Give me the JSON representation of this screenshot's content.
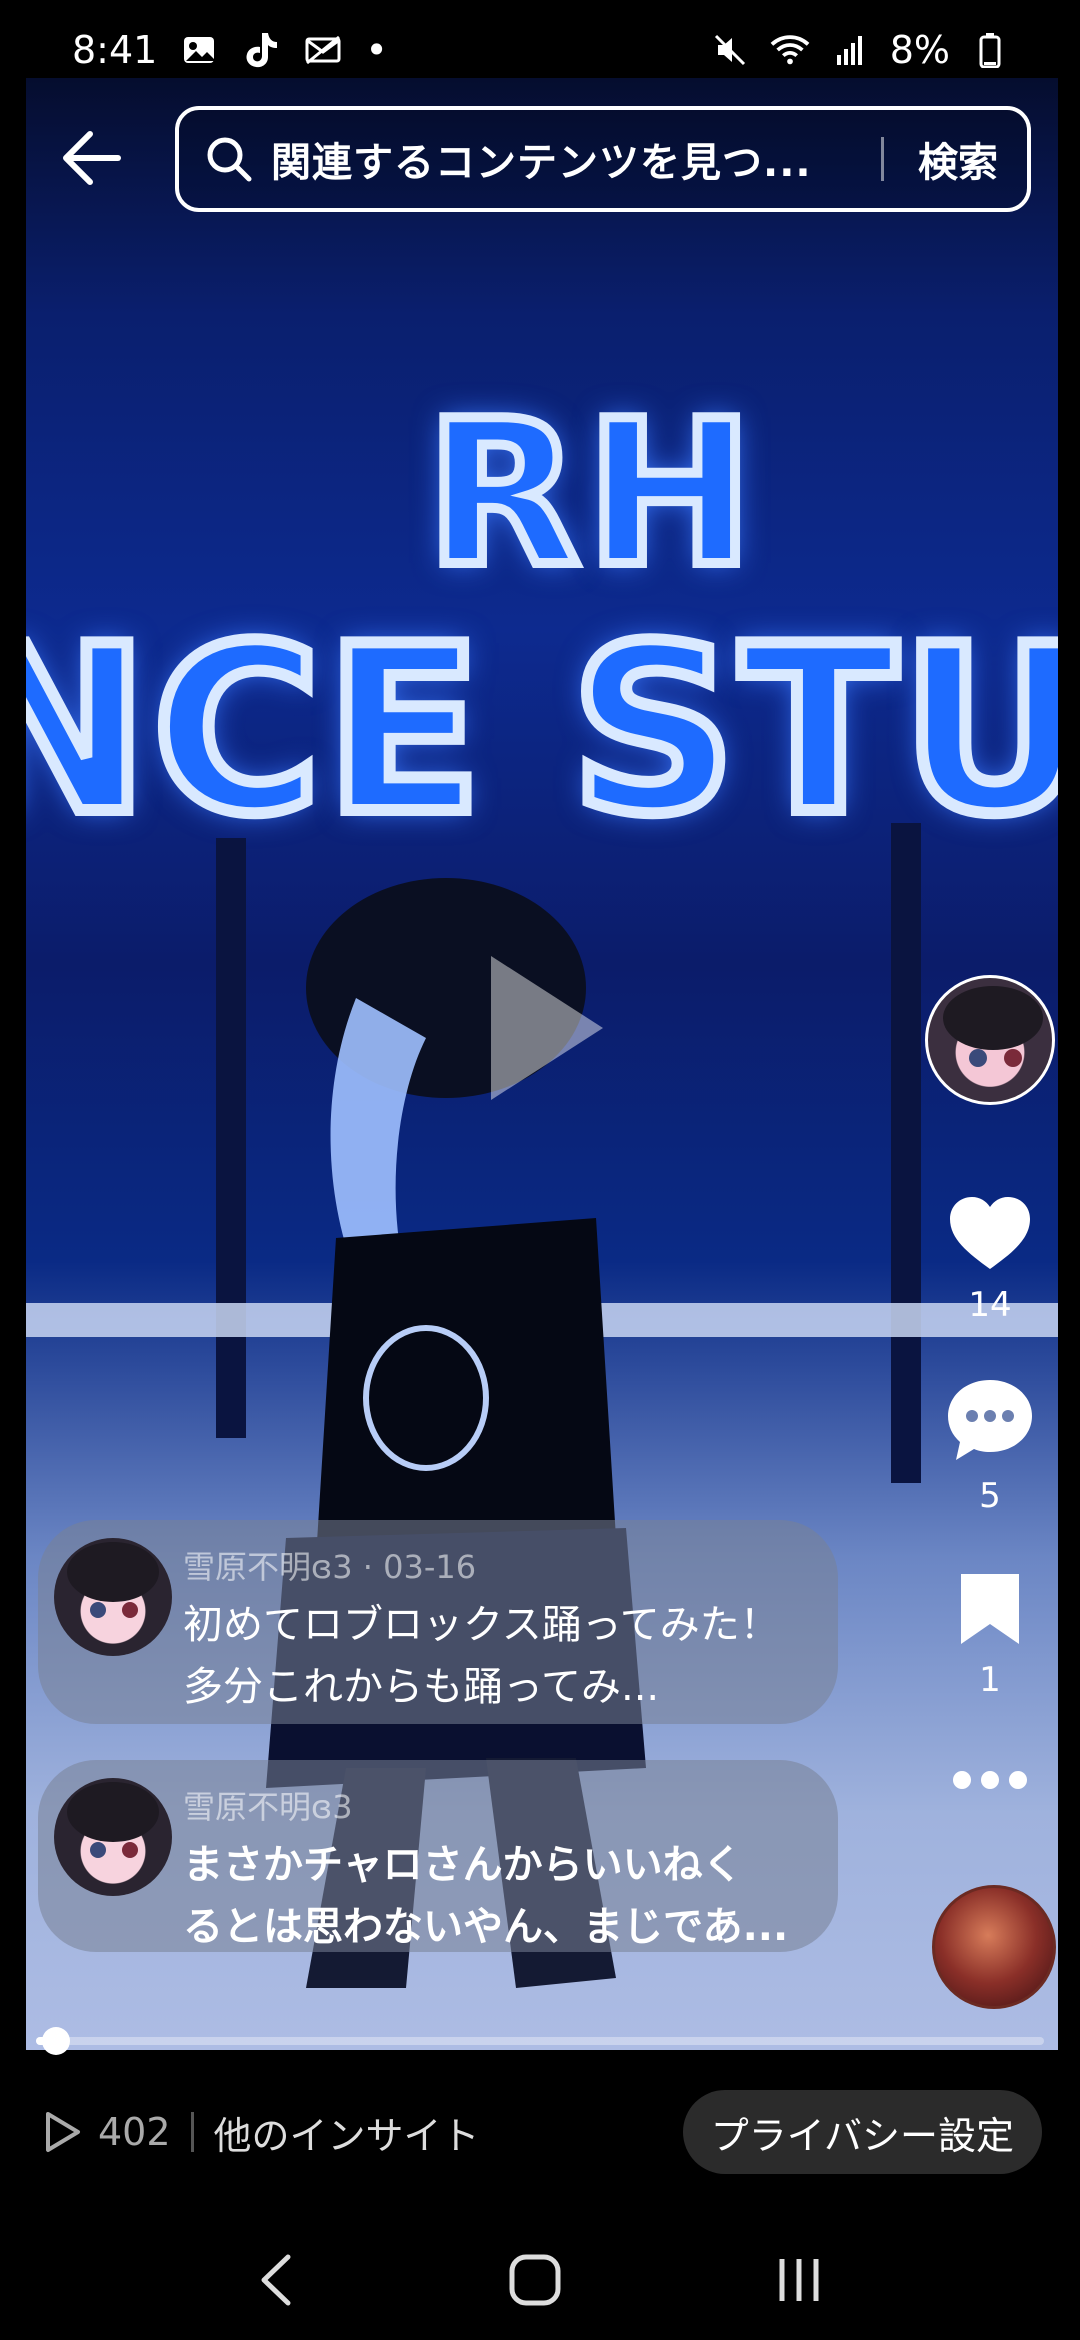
{
  "status_bar": {
    "time": "8:41",
    "battery": "8%",
    "dot": "•"
  },
  "search": {
    "placeholder": "関連するコンテンツを見つ...",
    "button_label": "検索"
  },
  "actions": {
    "likes": "14",
    "comments": "5",
    "saves": "1"
  },
  "comments": [
    {
      "meta": "雪原不明ɞ3 · 03-16",
      "text_line1": "初めてロブロックス踊ってみた！",
      "text_line2": "多分これからも踊ってみ..."
    },
    {
      "meta": "雪原不明ɞ3",
      "text_line1": "まさかチャロさんからいいねく",
      "text_line2": "るとは思わないやん、まじであ..."
    }
  ],
  "video": {
    "sign_line1": "RH",
    "sign_line2": "NCE STU",
    "progress_fraction": 0.02
  },
  "bottom": {
    "views": "402",
    "insight_label": "他のインサイト",
    "privacy_label": "プライバシー設定"
  },
  "colors": {
    "accent_blue": "#1e6bff",
    "bg": "#000000"
  }
}
